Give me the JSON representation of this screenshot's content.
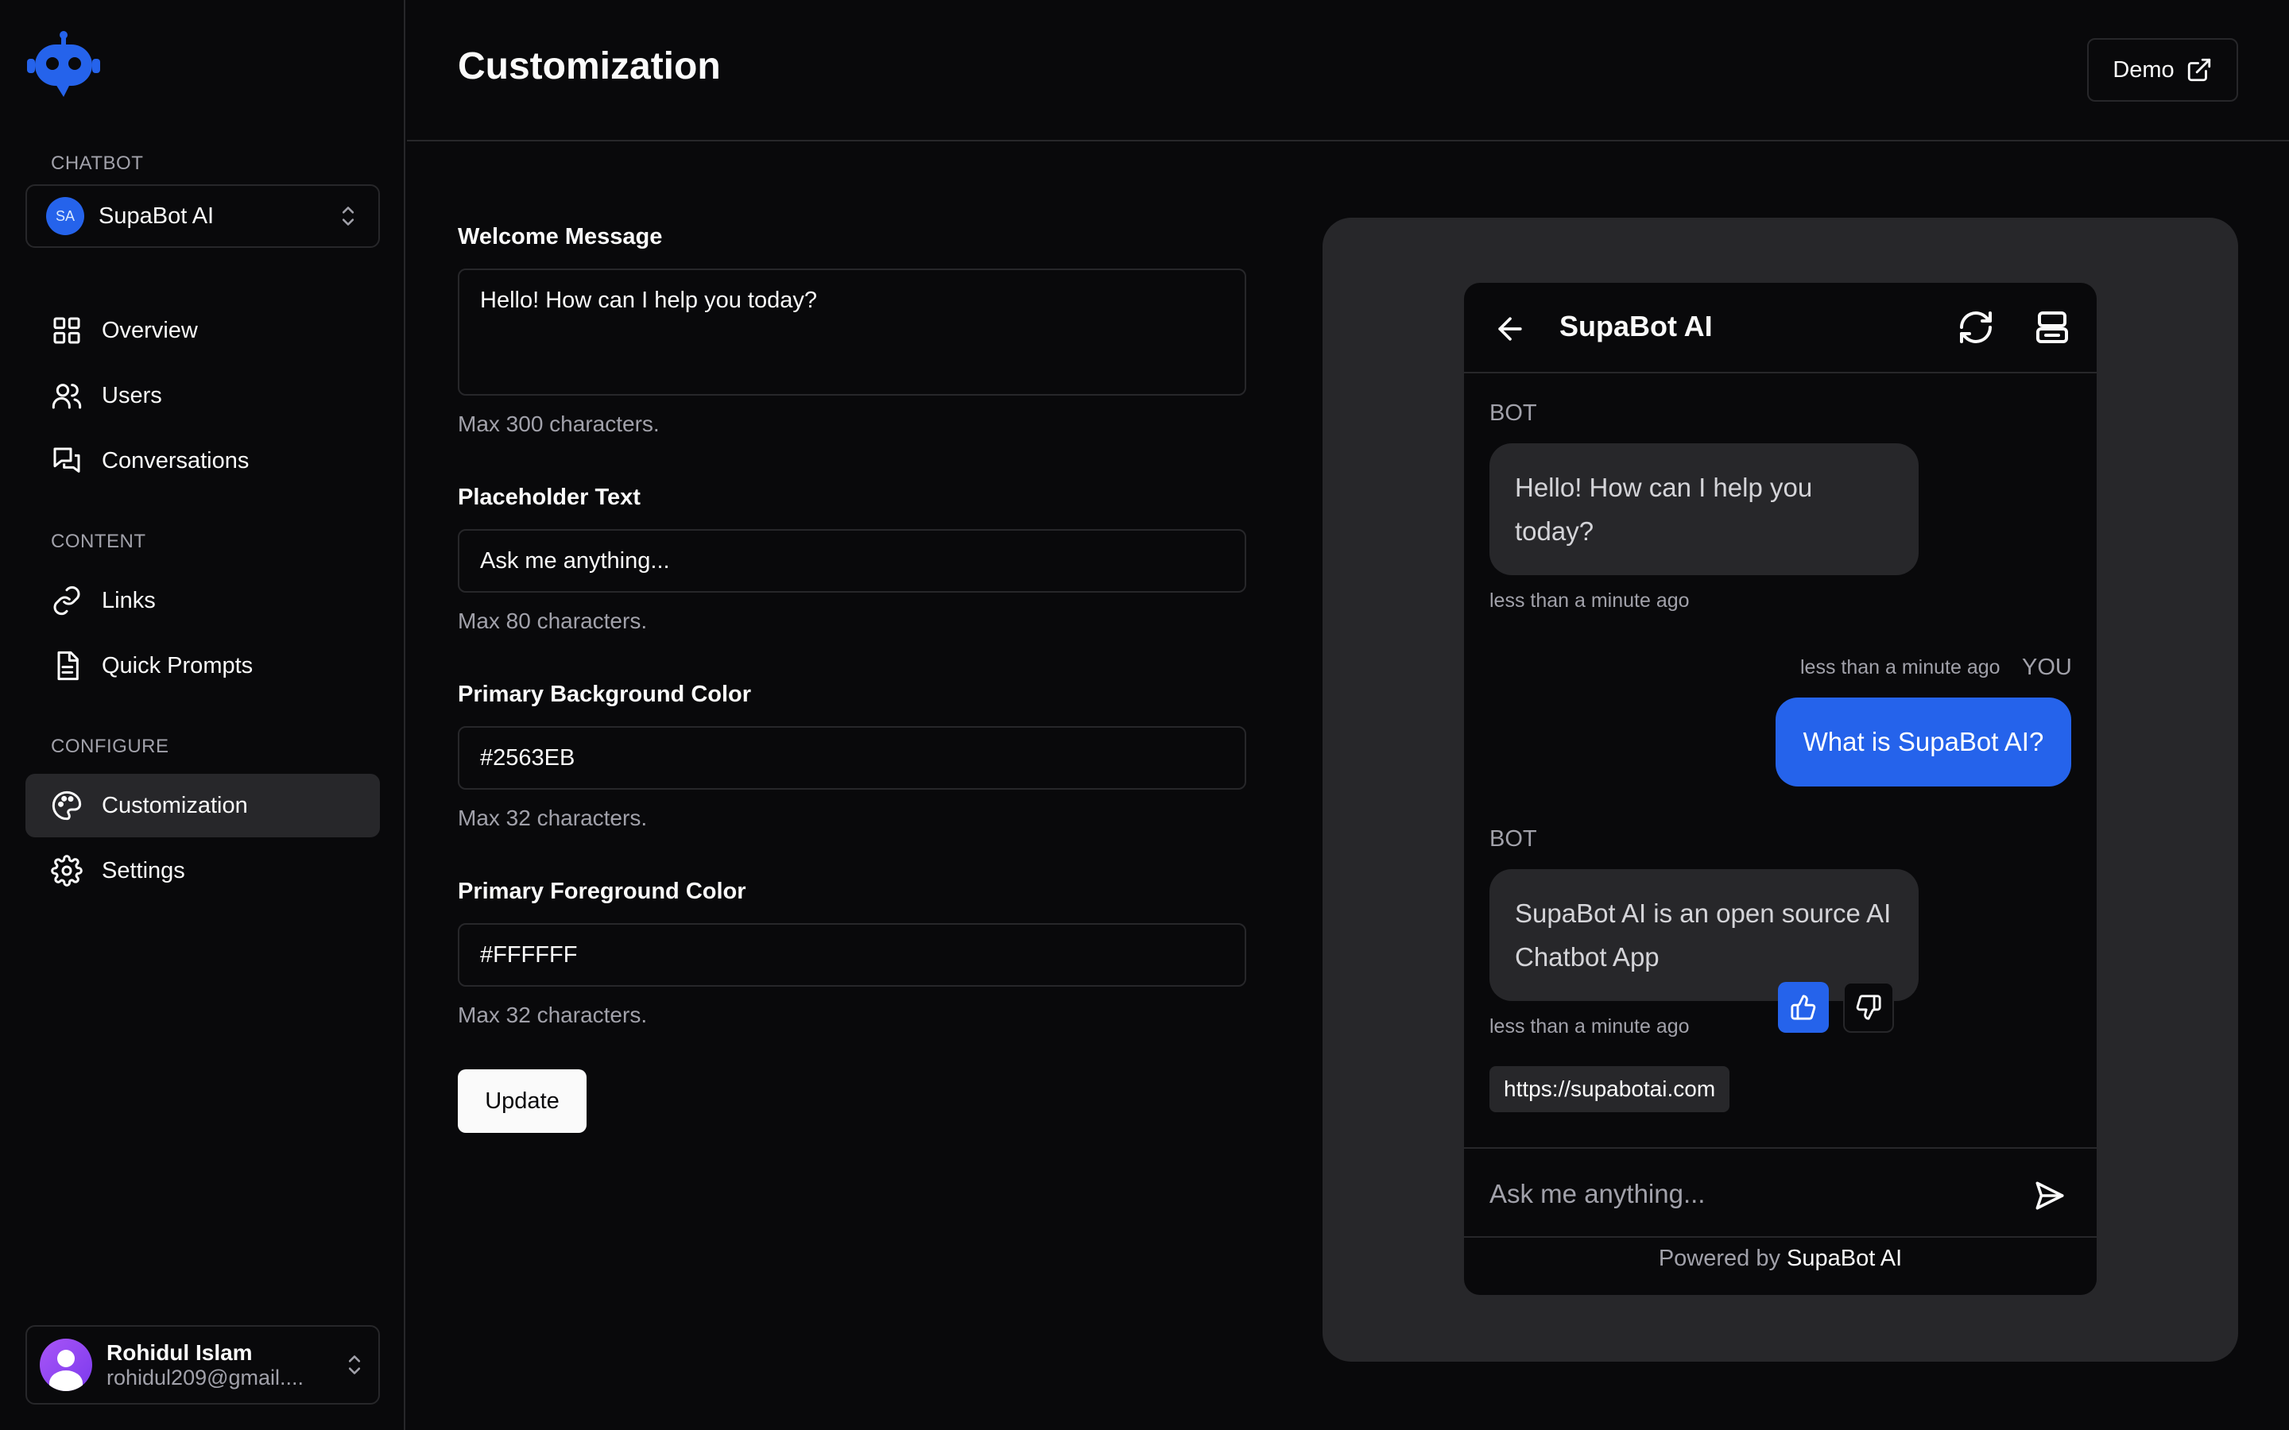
{
  "sidebar": {
    "chatbot_section": "CHATBOT",
    "selected_bot": {
      "initials": "SA",
      "name": "SupaBot AI"
    },
    "nav": [
      {
        "label": "Overview",
        "icon": "grid-icon"
      },
      {
        "label": "Users",
        "icon": "users-icon"
      },
      {
        "label": "Conversations",
        "icon": "messages-icon"
      }
    ],
    "content_section": "CONTENT",
    "content_nav": [
      {
        "label": "Links",
        "icon": "link-icon"
      },
      {
        "label": "Quick Prompts",
        "icon": "file-text-icon"
      }
    ],
    "configure_section": "CONFIGURE",
    "configure_nav": [
      {
        "label": "Customization",
        "icon": "palette-icon",
        "active": true
      },
      {
        "label": "Settings",
        "icon": "gear-icon"
      }
    ],
    "user": {
      "name": "Rohidul Islam",
      "email": "rohidul209@gmail...."
    }
  },
  "header": {
    "title": "Customization",
    "demo_label": "Demo"
  },
  "form": {
    "welcome": {
      "label": "Welcome Message",
      "value": "Hello! How can I help you today?",
      "help": "Max 300 characters."
    },
    "placeholder": {
      "label": "Placeholder Text",
      "value": "Ask me anything...",
      "help": "Max 80 characters."
    },
    "bg_color": {
      "label": "Primary Background Color",
      "value": "#2563EB",
      "help": "Max 32 characters."
    },
    "fg_color": {
      "label": "Primary Foreground Color",
      "value": "#FFFFFF",
      "help": "Max 32 characters."
    },
    "update_label": "Update"
  },
  "preview": {
    "title": "SupaBot AI",
    "messages": [
      {
        "role": "BOT",
        "text": "Hello! How can I help you today?",
        "time": "less than a minute ago"
      },
      {
        "role": "YOU",
        "text": "What is SupaBot AI?",
        "time": "less than a minute ago"
      },
      {
        "role": "BOT",
        "text": "SupaBot AI is an open source AI Chatbot App",
        "time": "less than a minute ago"
      }
    ],
    "link": "https://supabotai.com",
    "input_placeholder": "Ask me anything...",
    "powered_prefix": "Powered by",
    "powered_brand": "SupaBot AI"
  },
  "colors": {
    "accent": "#2563EB",
    "background": "#09090B",
    "surface": "#27272A",
    "muted_text": "#A1A1AA"
  }
}
